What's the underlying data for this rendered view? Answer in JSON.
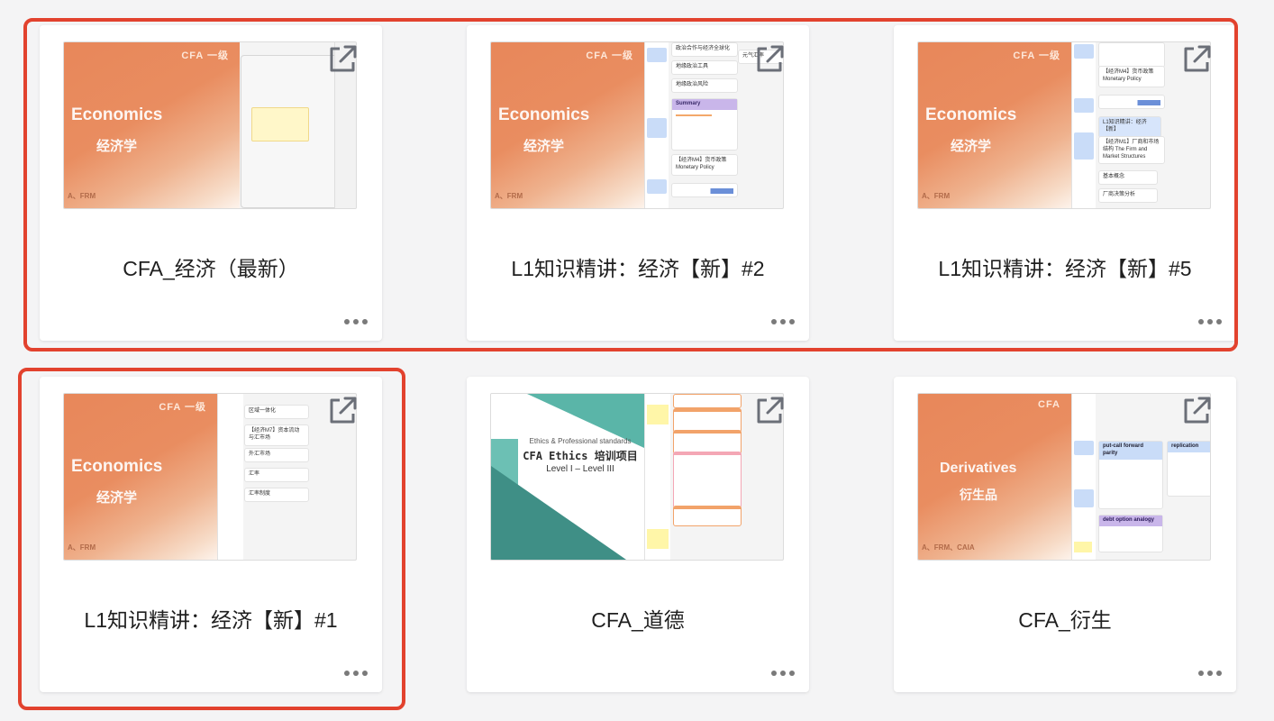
{
  "cards": [
    {
      "title": "CFA_经济（最新）",
      "thumbnail": {
        "tag": "CFA 一级",
        "en": "Economics",
        "cn": "经济学",
        "foot": "A、FRM"
      },
      "nodes": []
    },
    {
      "title": "L1知识精讲：经济【新】#2",
      "thumbnail": {
        "tag": "CFA 一级",
        "en": "Economics",
        "cn": "经济学",
        "foot": "A、FRM"
      },
      "nodes": [
        "政治合作与经济全球化",
        "地缘政治工具",
        "地缘政治风险",
        "Summary",
        "【经济M4】货币政策 Monetary Policy",
        "元气汇率"
      ]
    },
    {
      "title": "L1知识精讲：经济【新】#5",
      "thumbnail": {
        "tag": "CFA 一级",
        "en": "Economics",
        "cn": "经济学",
        "foot": "A、FRM"
      },
      "nodes": [
        "【经济M4】货币政策 Monetary Policy",
        "L1知识精讲：经济【新】",
        "【经济M1】厂商和市场结构 The Firm and Market Structures",
        "基本概念",
        "厂商决策分析"
      ]
    },
    {
      "title": "L1知识精讲：经济【新】#1",
      "thumbnail": {
        "tag": "CFA 一级",
        "en": "Economics",
        "cn": "经济学",
        "foot": "A、FRM"
      },
      "nodes": [
        "区域一体化",
        "【经济M7】资本流动与汇市场",
        "外汇市场",
        "汇率",
        "汇率制度"
      ]
    },
    {
      "title": "CFA_道德",
      "thumbnail": {
        "line1": "Ethics & Professional standards",
        "line2": "CFA Ethics 培训项目",
        "line3": "Level I – Level III"
      },
      "nodes": []
    },
    {
      "title": "CFA_衍生",
      "thumbnail": {
        "tag": "CFA",
        "en": "Derivatives",
        "cn": "衍生品",
        "foot": "A、FRM、CAIA"
      },
      "nodes": [
        "put-call forward parity",
        "replication",
        "debt option analogy"
      ]
    }
  ],
  "colors": {
    "selection": "#e2422e",
    "accent": "#e8875a",
    "open_icon": "#6b6f78"
  },
  "icons": {
    "open": "open-external-icon",
    "more": "more-dots-icon"
  }
}
